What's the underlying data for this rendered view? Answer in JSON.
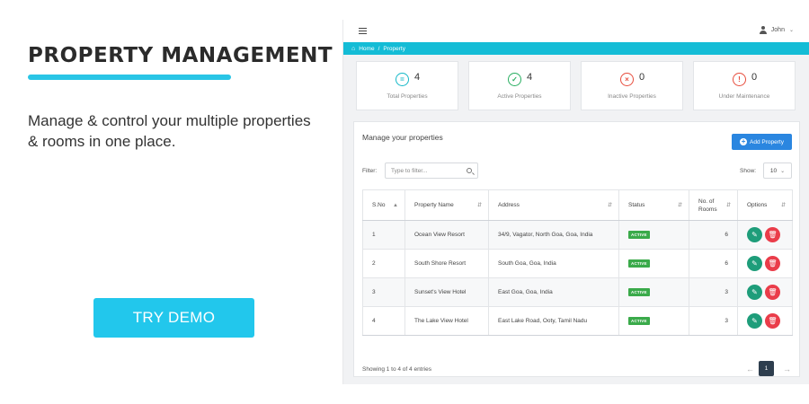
{
  "promo": {
    "title": "PROPERTY MANAGEMENT",
    "description": "Manage & control your multiple properties & rooms in one place.",
    "cta_label": "TRY DEMO",
    "accent_color": "#29c5e6"
  },
  "app": {
    "user_name": "John",
    "breadcrumb": [
      "Home",
      "/",
      "Property"
    ],
    "stats": [
      {
        "value": "4",
        "label": "Total Properties",
        "icon": "equals-circle-icon",
        "color": "#14b8c8"
      },
      {
        "value": "4",
        "label": "Active Properties",
        "icon": "check-circle-icon",
        "color": "#27ae60"
      },
      {
        "value": "0",
        "label": "Inactive Properties",
        "icon": "x-circle-icon",
        "color": "#e74c3c"
      },
      {
        "value": "0",
        "label": "Under Maintenance",
        "icon": "exclamation-circle-icon",
        "color": "#e74c3c"
      }
    ],
    "card_title": "Manage your properties",
    "add_button": "Add Property",
    "filter_label": "Filter:",
    "filter_placeholder": "Type to filter...",
    "show_label": "Show:",
    "show_value": "10",
    "columns": [
      "S.No",
      "Property Name",
      "Address",
      "Status",
      "No. of Rooms",
      "Options"
    ],
    "rows": [
      {
        "sno": "1",
        "name": "Ocean View Resort",
        "address": "34/9, Vagator, North Goa, Goa, India",
        "status": "ACTIVE",
        "rooms": "6"
      },
      {
        "sno": "2",
        "name": "South Shore Resort",
        "address": "South Goa, Goa, India",
        "status": "ACTIVE",
        "rooms": "6"
      },
      {
        "sno": "3",
        "name": "Sunset's View Hotel",
        "address": "East Goa, Goa, India",
        "status": "ACTIVE",
        "rooms": "3"
      },
      {
        "sno": "4",
        "name": "The Lake View Hotel",
        "address": "East Lake Road, Ooty, Tamil Nadu",
        "status": "ACTIVE",
        "rooms": "3"
      }
    ],
    "entries_text": "Showing 1 to 4 of 4 entries",
    "current_page": "1",
    "brand_color": "#14bcd6"
  }
}
